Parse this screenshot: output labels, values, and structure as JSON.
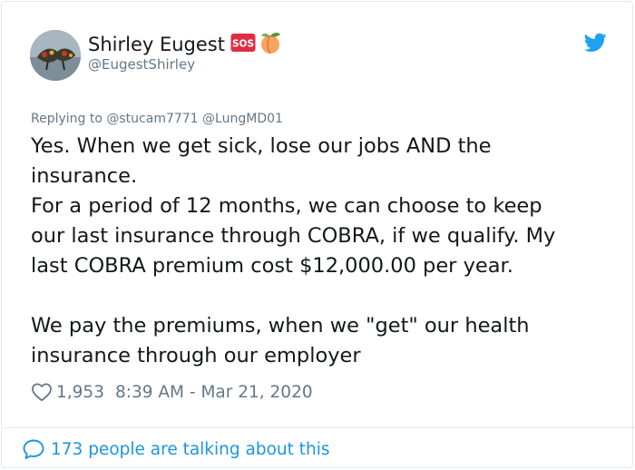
{
  "tweet": {
    "author": {
      "display_name": "Shirley Eugest",
      "handle": "@EugestShirley",
      "badges": [
        "sos-badge",
        "peach-emoji"
      ],
      "sos_text": "SOS"
    },
    "replying_to": {
      "prefix": "Replying to",
      "mentions": [
        "@stucam7771",
        "@LungMD01"
      ]
    },
    "text_lines": [
      "Yes. When we get sick, lose our jobs AND the",
      "insurance.",
      "For a period of 12 months, we can choose to keep",
      "our last insurance through COBRA, if we qualify. My",
      "last COBRA premium cost $12,000.00 per year.",
      "",
      "We pay the premiums, when we \"get\" our health",
      "insurance through our employer"
    ],
    "likes": "1,953",
    "timestamp": "8:39 AM - Mar 21, 2020",
    "talking_about": "173 people are talking about this"
  },
  "icons": {
    "brand": "twitter-bird-icon",
    "like": "heart-icon",
    "conversation": "speech-bubble-icon"
  },
  "colors": {
    "accent": "#1da1f2",
    "link": "#1b95e0",
    "secondary_text": "#657786",
    "sos_red": "#dd2e44",
    "peach": "#f4900c"
  }
}
